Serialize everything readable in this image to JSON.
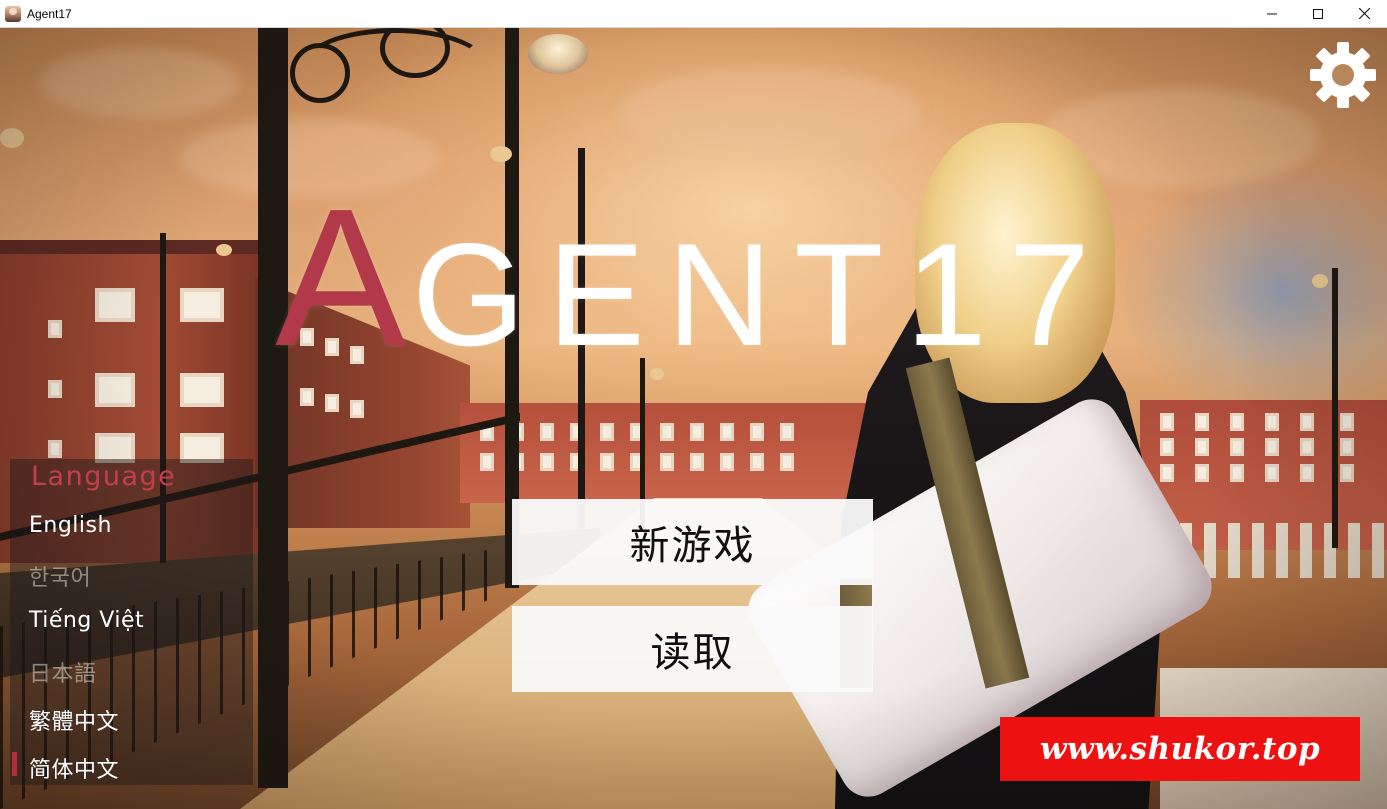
{
  "window": {
    "title": "Agent17",
    "controls": [
      "minimize-icon",
      "maximize-icon",
      "close-icon"
    ]
  },
  "logo": {
    "first_letter": "A",
    "rest": "GENT17",
    "accent_color": "#b13949"
  },
  "settings": {
    "icon": "gear-icon"
  },
  "language_panel": {
    "title": "Language",
    "items": [
      {
        "label": "English",
        "active": true
      },
      {
        "label": "한국어",
        "active": false
      },
      {
        "label": "Tiếng Việt",
        "active": true
      },
      {
        "label": "日本語",
        "active": false
      },
      {
        "label": "繁體中文",
        "active": true
      },
      {
        "label": "简体中文",
        "active": true,
        "selected": true
      }
    ],
    "selected_marker_color": "#b42d3c"
  },
  "main_menu": {
    "new_game": "新游戏",
    "load": "读取"
  },
  "watermark": {
    "text": "www.shukor.top",
    "background": "#ee1111"
  }
}
